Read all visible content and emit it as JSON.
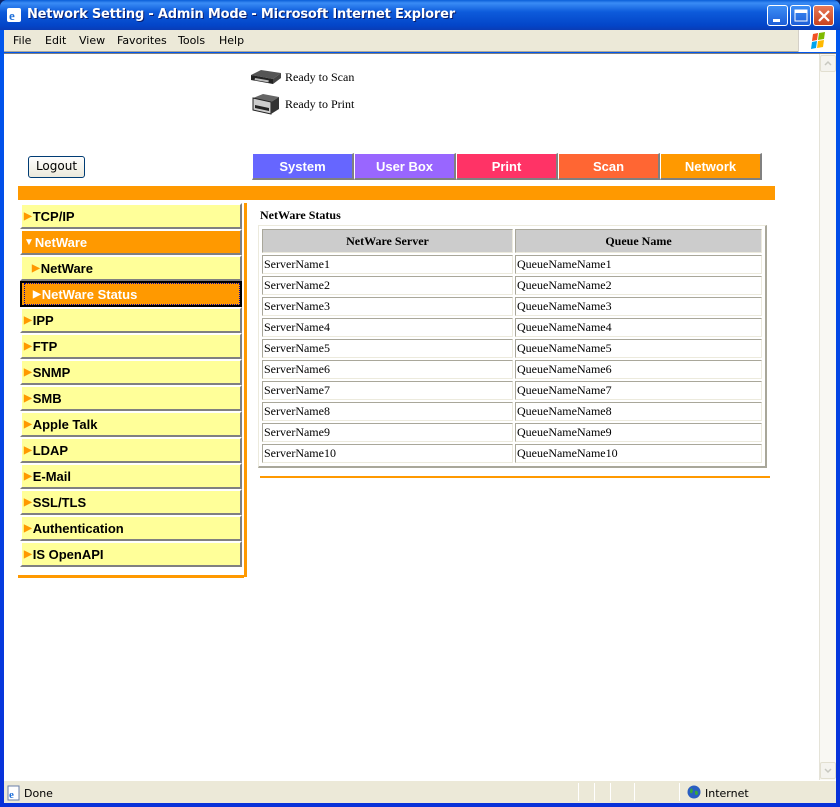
{
  "window": {
    "title": "Network Setting - Admin Mode - Microsoft Internet Explorer"
  },
  "menubar": {
    "items": [
      "File",
      "Edit",
      "View",
      "Favorites",
      "Tools",
      "Help"
    ]
  },
  "device_status": {
    "scan": "Ready to Scan",
    "print": "Ready to Print"
  },
  "logout_label": "Logout",
  "tabs": [
    {
      "label": "System",
      "color": "#6666ff"
    },
    {
      "label": "User Box",
      "color": "#9966ff"
    },
    {
      "label": "Print",
      "color": "#ff3366"
    },
    {
      "label": "Scan",
      "color": "#ff6633"
    },
    {
      "label": "Network",
      "color": "#ff9900"
    }
  ],
  "accent_color": "#ff9900",
  "sidebar": {
    "items": [
      {
        "label": "TCP/IP",
        "state": "collapsed"
      },
      {
        "label": "NetWare",
        "state": "expanded"
      },
      {
        "label": "NetWare",
        "state": "sub"
      },
      {
        "label": "NetWare Status",
        "state": "sub-active"
      },
      {
        "label": "IPP",
        "state": "collapsed"
      },
      {
        "label": "FTP",
        "state": "collapsed"
      },
      {
        "label": "SNMP",
        "state": "collapsed"
      },
      {
        "label": "SMB",
        "state": "collapsed"
      },
      {
        "label": "Apple Talk",
        "state": "collapsed"
      },
      {
        "label": "LDAP",
        "state": "collapsed"
      },
      {
        "label": "E-Mail",
        "state": "collapsed"
      },
      {
        "label": "SSL/TLS",
        "state": "collapsed"
      },
      {
        "label": "Authentication",
        "state": "collapsed"
      },
      {
        "label": "IS OpenAPI",
        "state": "collapsed"
      }
    ]
  },
  "content": {
    "title": "NetWare Status",
    "table": {
      "headers": [
        "NetWare Server",
        "Queue Name"
      ],
      "rows": [
        [
          "ServerName1",
          "QueueNameName1"
        ],
        [
          "ServerName2",
          "QueueNameName2"
        ],
        [
          "ServerName3",
          "QueueNameName3"
        ],
        [
          "ServerName4",
          "QueueNameName4"
        ],
        [
          "ServerName5",
          "QueueNameName5"
        ],
        [
          "ServerName6",
          "QueueNameName6"
        ],
        [
          "ServerName7",
          "QueueNameName7"
        ],
        [
          "ServerName8",
          "QueueNameName8"
        ],
        [
          "ServerName9",
          "QueueNameName9"
        ],
        [
          "ServerName10",
          "QueueNameName10"
        ]
      ]
    }
  },
  "statusbar": {
    "status": "Done",
    "zone": "Internet"
  }
}
